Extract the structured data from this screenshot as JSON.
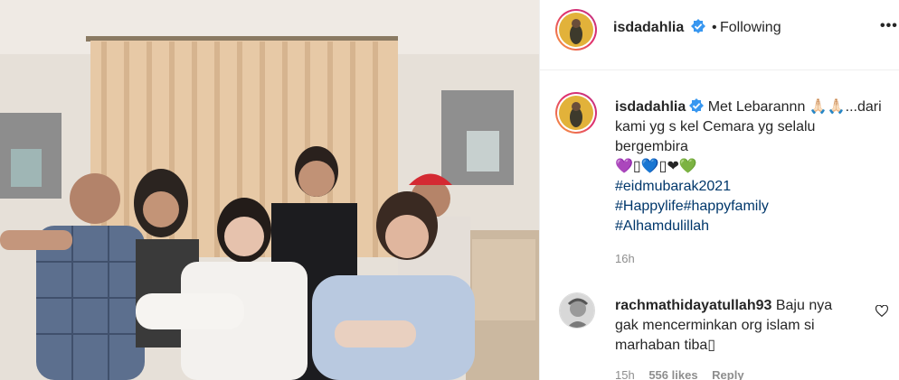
{
  "post": {
    "media_alt_icon": "video-frame"
  },
  "header": {
    "username": "isdadahlia",
    "separator": "•",
    "follow_status": "Following",
    "more_label": "•••"
  },
  "caption": {
    "username": "isdadahlia",
    "text_line1": "Met Lebarannn 🙏🏻🙏🏻...dari",
    "text_line2": "kami yg s kel Cemara yg selalu",
    "text_line3": "bergembira",
    "emoji_line": "💜▯💙▯❤💚",
    "hashtags": [
      "#eidmubarak2021",
      "#Happylife#happyfamily",
      "#Alhamdulillah"
    ],
    "time": "16h"
  },
  "comment": {
    "username": "rachmathidayatullah93",
    "text": "Baju nya gak mencerminkan org islam si marhaban tiba▯",
    "time": "15h",
    "likes": "556 likes",
    "reply_label": "Reply"
  },
  "colors": {
    "accent_link": "#00376b",
    "verified": "#3897f0",
    "muted": "#8e8e8e",
    "text": "#262626"
  }
}
